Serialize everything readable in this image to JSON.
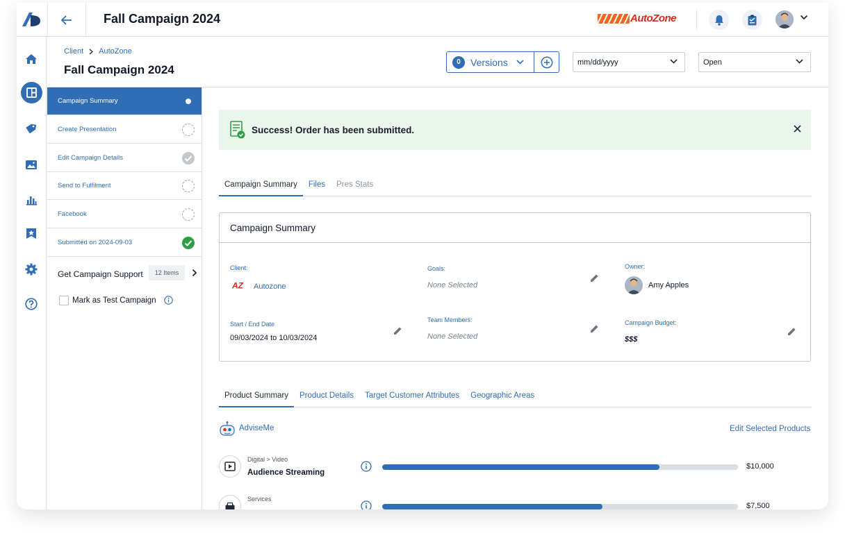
{
  "topbar": {
    "title": "Fall Campaign 2024",
    "brand": "AutoZone",
    "icons": [
      "logo-icon",
      "back-arrow-icon",
      "bell-icon",
      "clipboard-icon",
      "avatar",
      "chevron-down-icon"
    ]
  },
  "rail": {
    "items": [
      "home-icon",
      "dashboard-icon",
      "tag-icon",
      "image-icon",
      "bar-chart-icon",
      "bookmark-star-icon",
      "gear-icon",
      "help-icon"
    ],
    "active": "dashboard-icon"
  },
  "header": {
    "breadcrumb": [
      "Client",
      "AutoZone"
    ],
    "title": "Fall Campaign 2024",
    "versions_count": "0",
    "versions_label": "Versions",
    "date_value": "mm/dd/yyyy",
    "status_value": "Open"
  },
  "side": {
    "items": [
      {
        "label": "Campaign Summary",
        "status": "current"
      },
      {
        "label": "Create Presentation",
        "status": "pending"
      },
      {
        "label": "Edit Campaign Details",
        "status": "done-grey"
      },
      {
        "label": "Send to Fulfilment",
        "status": "pending"
      },
      {
        "label": "Facebook",
        "status": "pending"
      },
      {
        "label": "Submitted on 2024-09-03",
        "status": "done-green"
      }
    ],
    "support_label": "Get Campaign Support",
    "support_count": "12 Items",
    "test_label": "Mark as Test Campaign"
  },
  "alert": {
    "text": "Success! Order has been submitted."
  },
  "tabs": [
    "Campaign Summary",
    "Files",
    "Pres Stats"
  ],
  "summary": {
    "title": "Campaign Summary",
    "client_label": "Client:",
    "client_logo": "AZ",
    "client_value": "Autozone",
    "goals_label": "Goals:",
    "goals_value": "None Selected",
    "owner_label": "Owner:",
    "owner_value": "Amy Apples",
    "dates_label": "Start / End Date",
    "dates_value": "09/03/2024 to 10/03/2024",
    "team_label": "Team Members:",
    "team_value": "None Selected",
    "budget_label": "Campaign Budget:",
    "budget_value": "$$$"
  },
  "product_tabs": [
    "Product Summary",
    "Product Details",
    "Target Customer Attributes",
    "Geographic Areas"
  ],
  "advise_label": "AdviseMe",
  "edit_products_label": "Edit Selected Products",
  "products": [
    {
      "category": "Digital > Video",
      "name": "Audience Streaming",
      "amount": "$10,000",
      "fill": 0.78
    },
    {
      "category": "Services",
      "name": "",
      "amount": "$7,500",
      "fill": 0.62
    }
  ],
  "colors": {
    "accent": "#2f6db5",
    "success": "#2e9e45",
    "alert_bg": "#eaf5ec",
    "brand_orange": "#f26722",
    "brand_red": "#d52b1e"
  }
}
